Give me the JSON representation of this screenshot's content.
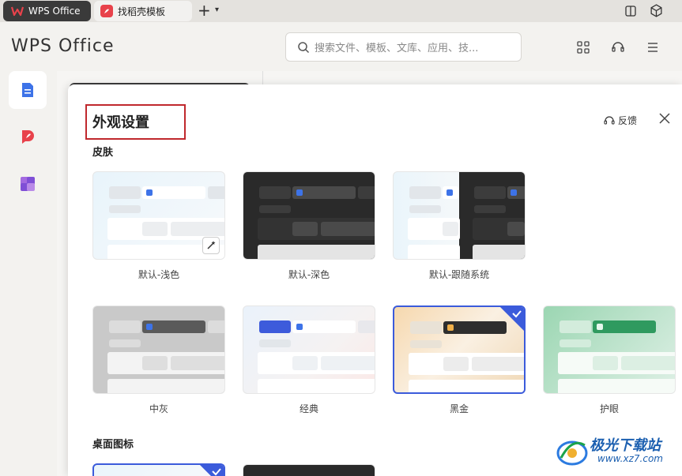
{
  "tabs": [
    {
      "label": "WPS Office"
    },
    {
      "label": "找稻壳模板"
    }
  ],
  "header": {
    "brand": "WPS Office",
    "search_placeholder": "搜索文件、模板、文库、应用、技..."
  },
  "dialog": {
    "title": "外观设置",
    "feedback_label": "反馈",
    "section_skin": "皮肤",
    "section_icons": "桌面图标",
    "skins": [
      {
        "label": "默认-浅色",
        "selected": false
      },
      {
        "label": "默认-深色",
        "selected": false
      },
      {
        "label": "默认-跟随系统",
        "selected": false
      },
      {
        "label": "中灰",
        "selected": false
      },
      {
        "label": "经典",
        "selected": false
      },
      {
        "label": "黑金",
        "selected": true
      },
      {
        "label": "护眼",
        "selected": false
      }
    ]
  },
  "watermark": {
    "title": "极光下载站",
    "url": "www.xz7.com"
  },
  "colors": {
    "accent": "#3b5bdb",
    "highlight_box": "#c0282d"
  }
}
